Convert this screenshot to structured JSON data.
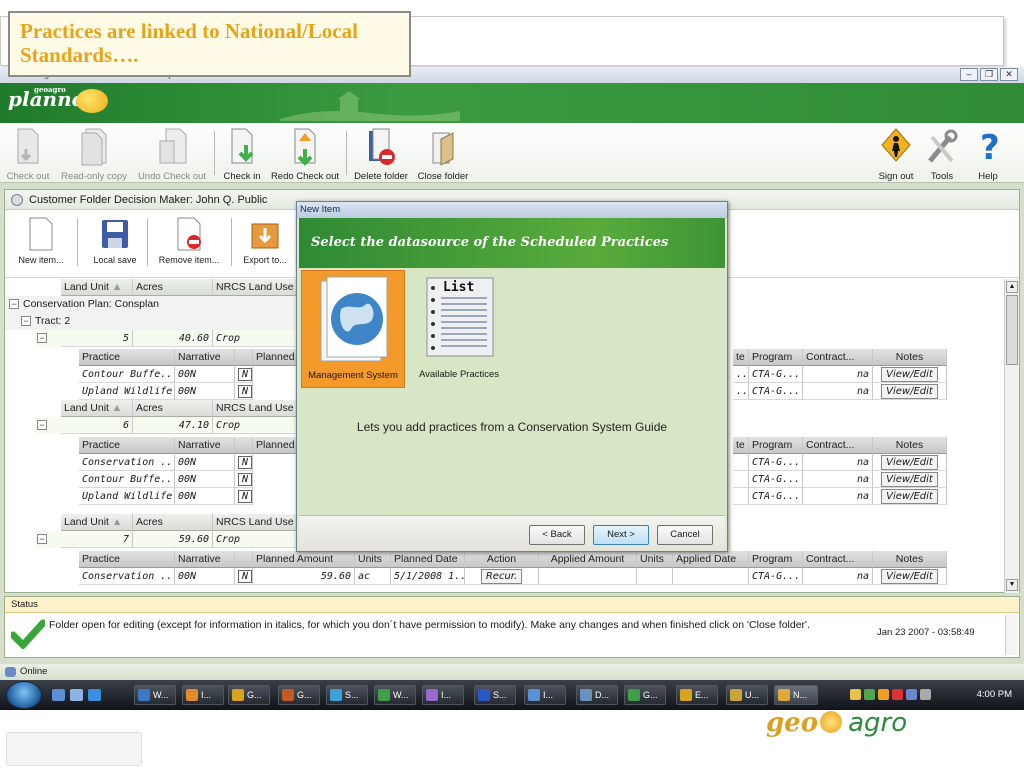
{
  "_note": "Some wording here is approximate: the source text was too small or blurry to read with certainty.",
  "slide": {
    "caption": "Practices are linked to National/Local Standards….",
    "footer_logo_geo": "geo",
    "footer_logo_agro": "agro"
  },
  "app": {
    "title": "GeoAgro Conservation Planner Alpha Viewer",
    "window_buttons": [
      "–",
      "❐",
      "✕"
    ],
    "brand_small": "geoagro",
    "brand": "planner",
    "toolbar": [
      {
        "label": "Check out",
        "icon": "checkout-icon",
        "enabled": false
      },
      {
        "label": "Read-only copy",
        "icon": "readonly-copy-icon",
        "enabled": false
      },
      {
        "label": "Undo Check out",
        "icon": "undo-checkout-icon",
        "enabled": false
      },
      {
        "label": "Check in",
        "icon": "checkin-icon",
        "enabled": true
      },
      {
        "label": "Redo Check out",
        "icon": "redo-checkout-icon",
        "enabled": true
      },
      {
        "label": "Delete folder",
        "icon": "delete-folder-icon",
        "enabled": true
      },
      {
        "label": "Close folder",
        "icon": "close-folder-icon",
        "enabled": true
      }
    ],
    "toolbar_right": [
      {
        "label": "Sign out",
        "icon": "sign-out-icon"
      },
      {
        "label": "Tools",
        "icon": "tools-icon"
      },
      {
        "label": "Help",
        "icon": "help-icon"
      }
    ],
    "colors": {
      "accent_green": "#2f8c35",
      "status_yellow": "#fdf2c9",
      "selected_orange": "#f39a2a"
    }
  },
  "folder": {
    "title": "Customer Folder Decision Maker: John Q. Public",
    "tools": [
      {
        "label": "New item...",
        "icon": "new-item-icon"
      },
      {
        "label": "Local save",
        "icon": "save-icon"
      },
      {
        "label": "Remove item...",
        "icon": "remove-item-icon"
      },
      {
        "label": "Export to...",
        "icon": "export-icon"
      }
    ],
    "grid": {
      "land_headers": [
        "Land Unit",
        "Acres",
        "NRCS Land Use"
      ],
      "plan_label": "Conservation Plan:  Consplan",
      "tract_label": "Tract: 2",
      "practice_headers": [
        "Practice",
        "Narrative",
        "",
        "Planned Amount",
        "Units",
        "Planned Date",
        "Action",
        "Applied Amount",
        "Units",
        "Applied Date",
        "Program",
        "Contract...",
        "Notes"
      ],
      "practice_headers_partial": [
        "Practice",
        "Narrative",
        "",
        "Planned",
        "te",
        "Program",
        "Contract...",
        "Notes"
      ],
      "land_units": [
        {
          "unit": "5",
          "acres": "40.60",
          "land_use": "Crop",
          "practices": [
            {
              "name": "Contour Buffe...",
              "narrative": "00N",
              "flag": "N",
              "date_tail": "..",
              "program": "CTA-G...",
              "contract": "na",
              "notes": "View/Edit"
            },
            {
              "name": "Upland Wildlife...",
              "narrative": "00N",
              "flag": "N",
              "date_tail": "..",
              "program": "CTA-G...",
              "contract": "na",
              "notes": "View/Edit"
            }
          ]
        },
        {
          "unit": "6",
          "acres": "47.10",
          "land_use": "Crop",
          "practices": [
            {
              "name": "Conservation ...",
              "narrative": "00N",
              "flag": "N",
              "date_tail": "",
              "program": "CTA-G...",
              "contract": "na",
              "notes": "View/Edit"
            },
            {
              "name": "Contour Buffe...",
              "narrative": "00N",
              "flag": "N",
              "date_tail": "",
              "program": "CTA-G...",
              "contract": "na",
              "notes": "View/Edit"
            },
            {
              "name": "Upland Wildlife...",
              "narrative": "00N",
              "flag": "N",
              "date_tail": "",
              "program": "CTA-G...",
              "contract": "na",
              "notes": "View/Edit"
            }
          ]
        },
        {
          "unit": "7",
          "acres": "59.60",
          "land_use": "Crop",
          "practices": [
            {
              "name": "Conservation ...",
              "narrative": "00N",
              "flag": "N",
              "planned_amount": "59.60",
              "units": "ac",
              "planned_date": "5/1/2008 1...",
              "action": "Recur.",
              "program": "CTA-G...",
              "contract": "na",
              "notes": "View/Edit"
            }
          ]
        }
      ]
    }
  },
  "status": {
    "label": "Status",
    "message": "Folder open for editing (except for information in italics, for which you don´t have permission to modify). Make any changes and when finished click on 'Close folder'.",
    "timestamp": "Jan 23 2007 - 03:58:49"
  },
  "online": {
    "label": "Online"
  },
  "modal": {
    "title": "New Item",
    "banner": "Select the datasource of the Scheduled Practices",
    "choices": [
      {
        "label": "Management System",
        "icon": "globe-document-icon",
        "selected": true
      },
      {
        "label": "Available Practices",
        "icon": "list-notepad-icon",
        "selected": false
      }
    ],
    "list_icon_text": "List",
    "description": "Lets you add practices from a Conservation System Guide",
    "buttons": {
      "back": "< Back",
      "next": "Next >",
      "cancel": "Cancel"
    }
  },
  "taskbar": {
    "tasks": [
      {
        "label": "W...",
        "color": "#3b78c4"
      },
      {
        "label": "I...",
        "color": "#e38b2c"
      },
      {
        "label": "G...",
        "color": "#d8a21c"
      },
      {
        "label": "G...",
        "color": "#c25b1f"
      },
      {
        "label": "S...",
        "color": "#3aa0d9"
      },
      {
        "label": "W...",
        "color": "#3f9e48"
      },
      {
        "label": "I...",
        "color": "#9a6ad1"
      },
      {
        "label": "S...",
        "color": "#2b58c4"
      },
      {
        "label": "I...",
        "color": "#5b8fd6"
      },
      {
        "label": "D...",
        "color": "#6d8fbf"
      },
      {
        "label": "G...",
        "color": "#3f9e48"
      },
      {
        "label": "E...",
        "color": "#d8a21c"
      },
      {
        "label": "U...",
        "color": "#c9a43a"
      },
      {
        "label": "N...",
        "color": "#e1a83a"
      }
    ],
    "clock": "4:00 PM"
  }
}
